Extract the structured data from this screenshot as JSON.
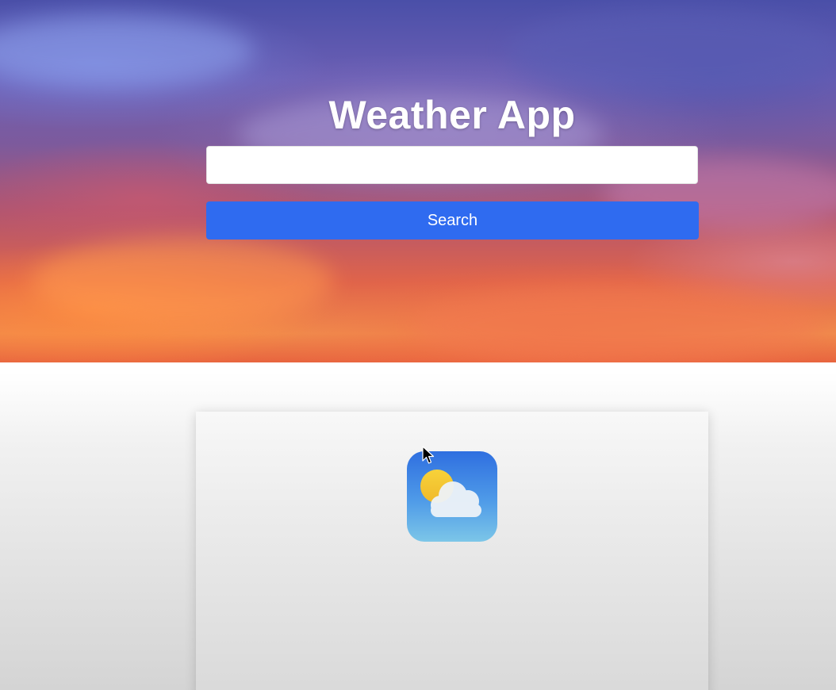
{
  "app": {
    "title": "Weather App"
  },
  "search": {
    "value": "",
    "placeholder": "",
    "button_label": "Search"
  },
  "result_card": {
    "icon": "partly-cloudy-icon"
  },
  "colors": {
    "button": "#2f6bf0",
    "title_text": "#ffffff",
    "card_background": "#ececec"
  }
}
